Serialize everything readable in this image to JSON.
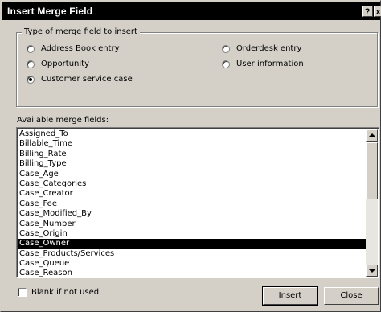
{
  "dialog": {
    "title": "Insert Merge Field",
    "help_label": "?",
    "close_label": "x"
  },
  "merge_type": {
    "legend": "Type of merge field to insert",
    "options": [
      {
        "label": "Address Book entry",
        "selected": false
      },
      {
        "label": "Opportunity",
        "selected": false
      },
      {
        "label": "Customer service case",
        "selected": true
      },
      {
        "label": "Orderdesk entry",
        "selected": false
      },
      {
        "label": "User information",
        "selected": false
      }
    ]
  },
  "fields": {
    "label": "Available merge fields:",
    "items": [
      "Assigned_To",
      "Billable_Time",
      "Billing_Rate",
      "Billing_Type",
      "Case_Age",
      "Case_Categories",
      "Case_Creator",
      "Case_Fee",
      "Case_Modified_By",
      "Case_Number",
      "Case_Origin",
      "Case_Owner",
      "Case_Products/Services",
      "Case_Queue",
      "Case_Reason"
    ],
    "selected_index": 11
  },
  "blank_if_not_used": {
    "label": "Blank if not used",
    "checked": false
  },
  "buttons": {
    "insert": "Insert",
    "close": "Close"
  }
}
